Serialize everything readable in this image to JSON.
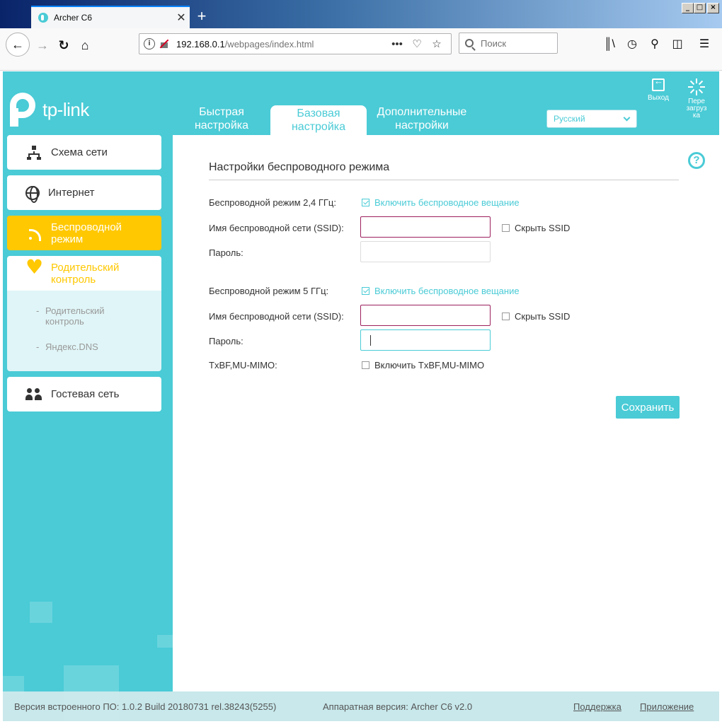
{
  "browser": {
    "tab_title": "Archer C6",
    "tab_close": "✕",
    "new_tab": "+",
    "url_host": "192.168.0.1",
    "url_path": "/webpages/index.html",
    "url_more": "•••",
    "search_placeholder": "Поиск",
    "icons": [
      "back-icon",
      "forward-icon",
      "reload-icon",
      "home-icon",
      "site-info-icon",
      "insecure-lock-icon",
      "page-actions-icon",
      "pocket-icon",
      "bookmark-star-icon",
      "search-icon",
      "library-icon",
      "history-icon",
      "zoom-icon",
      "reader-icon",
      "menu-icon"
    ]
  },
  "header": {
    "logo_text": "tp-link",
    "tabs": [
      {
        "label_line1": "Быстрая",
        "label_line2": "настройка",
        "active": false
      },
      {
        "label_line1": "Базовая",
        "label_line2": "настройка",
        "active": true
      },
      {
        "label_line1": "Дополнительные",
        "label_line2": "настройки",
        "active": false
      }
    ],
    "language": "Русский",
    "exit_label": "Выход",
    "reboot_line1": "Пере",
    "reboot_line2": "загруз",
    "reboot_line3": "ка"
  },
  "sidebar": {
    "items": [
      {
        "label": "Схема сети",
        "icon": "network-map-icon"
      },
      {
        "label": "Интернет",
        "icon": "globe-icon"
      },
      {
        "label_line1": "Беспроводной",
        "label_line2": "режим",
        "icon": "wireless-icon",
        "active": true
      },
      {
        "label_line1": "Родительский",
        "label_line2": "контроль",
        "icon": "heart-icon"
      },
      {
        "label": "Гостевая сеть",
        "icon": "guest-network-icon"
      }
    ],
    "subitems": [
      {
        "label_line1": "Родительский",
        "label_line2": "контроль"
      },
      {
        "label": "Яндекс.DNS"
      }
    ],
    "sub_dash": "-"
  },
  "content": {
    "title": "Настройки беспроводного режима",
    "band24": {
      "label": "Беспроводной режим 2,4 ГГц:",
      "enable_label": "Включить беспроводное вещание",
      "enabled": true,
      "ssid_label": "Имя беспроводной сети (SSID):",
      "ssid_value": "",
      "hide_ssid_label": "Скрыть SSID",
      "password_label": "Пароль:",
      "password_value": ""
    },
    "band5": {
      "label": "Беспроводной режим 5 ГГц:",
      "enable_label": "Включить беспроводное вещание",
      "enabled": true,
      "ssid_label": "Имя беспроводной сети (SSID):",
      "ssid_value": "",
      "hide_ssid_label": "Скрыть SSID",
      "password_label": "Пароль:",
      "password_value": ""
    },
    "txbf_label": "TxBF,MU-MIMO:",
    "txbf_enable_label": "Включить TxBF,MU-MIMO",
    "txbf_enabled": false,
    "save_label": "Сохранить",
    "help": "?"
  },
  "footer": {
    "firmware": "Версия встроенного ПО: 1.0.2 Build 20180731 rel.38243(5255)",
    "hardware": "Аппаратная версия: Archer C6 v2.0",
    "support": "Поддержка",
    "app": "Приложение"
  },
  "colors": {
    "brand": "#4acbd6",
    "active_menu": "#ffc800",
    "error_border": "#9b1f5c"
  }
}
